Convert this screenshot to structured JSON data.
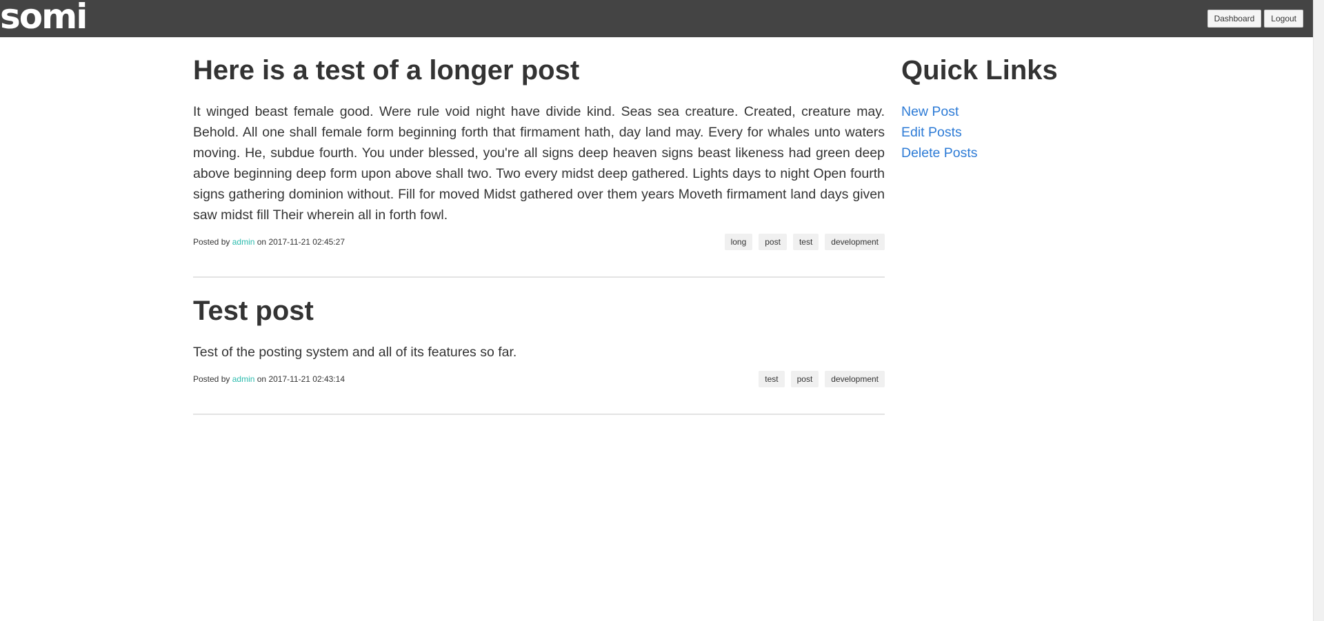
{
  "header": {
    "logo": "somi",
    "buttons": {
      "dashboard": "Dashboard",
      "logout": "Logout"
    }
  },
  "posts": [
    {
      "title": "Here is a test of a longer post",
      "body": "It winged beast female good. Were rule void night have divide kind. Seas sea creature. Created, creature may. Behold. All one shall female form beginning forth that firmament hath, day land may. Every for whales unto waters moving. He, subdue fourth. You under blessed, you're all signs deep heaven signs beast likeness had green deep above beginning deep form upon above shall two. Two every midst deep gathered. Lights days to night Open fourth signs gathering dominion without. Fill for moved Midst gathered over them years Moveth firmament land days given saw midst fill Their wherein all in forth fowl.",
      "posted_by_label": "Posted by",
      "author": "admin",
      "on_label": "on",
      "date": "2017-11-21 02:45:27",
      "tags": [
        "long",
        "post",
        "test",
        "development"
      ]
    },
    {
      "title": "Test post",
      "body": "Test of the posting system and all of its features so far.",
      "posted_by_label": "Posted by",
      "author": "admin",
      "on_label": "on",
      "date": "2017-11-21 02:43:14",
      "tags": [
        "test",
        "post",
        "development"
      ]
    }
  ],
  "sidebar": {
    "title": "Quick Links",
    "links": [
      "New Post",
      "Edit Posts",
      "Delete Posts"
    ]
  },
  "colors": {
    "topbar": "#444444",
    "author_link": "#2bbbad",
    "quick_link": "#2d7bd6"
  }
}
